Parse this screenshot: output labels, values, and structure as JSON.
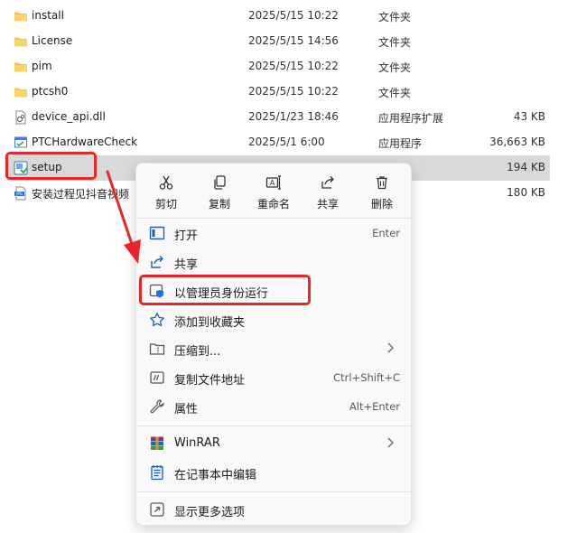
{
  "files": [
    {
      "name": "install",
      "date": "2025/5/15 10:22",
      "type": "文件夹",
      "size": "",
      "icon": "folder-icon"
    },
    {
      "name": "License",
      "date": "2025/5/15 14:56",
      "type": "文件夹",
      "size": "",
      "icon": "folder-icon"
    },
    {
      "name": "pim",
      "date": "2025/5/15 10:22",
      "type": "文件夹",
      "size": "",
      "icon": "folder-icon"
    },
    {
      "name": "ptcsh0",
      "date": "2025/5/15 10:22",
      "type": "文件夹",
      "size": "",
      "icon": "folder-icon"
    },
    {
      "name": "device_api.dll",
      "date": "2025/1/23 18:46",
      "type": "应用程序扩展",
      "size": "43 KB",
      "icon": "dll-file-icon"
    },
    {
      "name": "PTCHardwareCheck",
      "date": "2025/5/1 6:00",
      "type": "应用程序",
      "size": "36,663 KB",
      "icon": "app-icon"
    },
    {
      "name": "setup",
      "date": "",
      "type": "序",
      "size": "194 KB",
      "icon": "installer-icon"
    },
    {
      "name": "安装过程见抖音视频",
      "date": "",
      "type": "片文件",
      "size": "180 KB",
      "icon": "jpg-file-icon"
    }
  ],
  "quick_actions": [
    {
      "label": "剪切",
      "icon": "cut-icon"
    },
    {
      "label": "复制",
      "icon": "copy-icon"
    },
    {
      "label": "重命名",
      "icon": "rename-icon"
    },
    {
      "label": "共享",
      "icon": "share-icon"
    },
    {
      "label": "删除",
      "icon": "delete-icon"
    }
  ],
  "menu_items": [
    {
      "label": "打开",
      "shortcut": "Enter",
      "icon": "open-icon",
      "submenu": false
    },
    {
      "label": "共享",
      "shortcut": "",
      "icon": "share-icon",
      "submenu": false
    },
    {
      "label": "以管理员身份运行",
      "shortcut": "",
      "icon": "admin-shield-icon",
      "submenu": false
    },
    {
      "label": "添加到收藏夹",
      "shortcut": "",
      "icon": "star-icon",
      "submenu": false
    },
    {
      "label": "压缩到...",
      "shortcut": "",
      "icon": "compress-icon",
      "submenu": true
    },
    {
      "label": "复制文件地址",
      "shortcut": "Ctrl+Shift+C",
      "icon": "copy-path-icon",
      "submenu": false
    },
    {
      "label": "属性",
      "shortcut": "Alt+Enter",
      "icon": "properties-wrench-icon",
      "submenu": false
    },
    {
      "label": "WinRAR",
      "shortcut": "",
      "icon": "winrar-icon",
      "submenu": true
    },
    {
      "label": "在记事本中编辑",
      "shortcut": "",
      "icon": "notepad-icon",
      "submenu": false
    },
    {
      "label": "显示更多选项",
      "shortcut": "",
      "icon": "more-options-icon",
      "submenu": false
    }
  ],
  "colors": {
    "highlight": "#e8262a",
    "folder": "#f4c542",
    "accent": "#1a73e8",
    "selected_row": "#d9d9d9"
  }
}
